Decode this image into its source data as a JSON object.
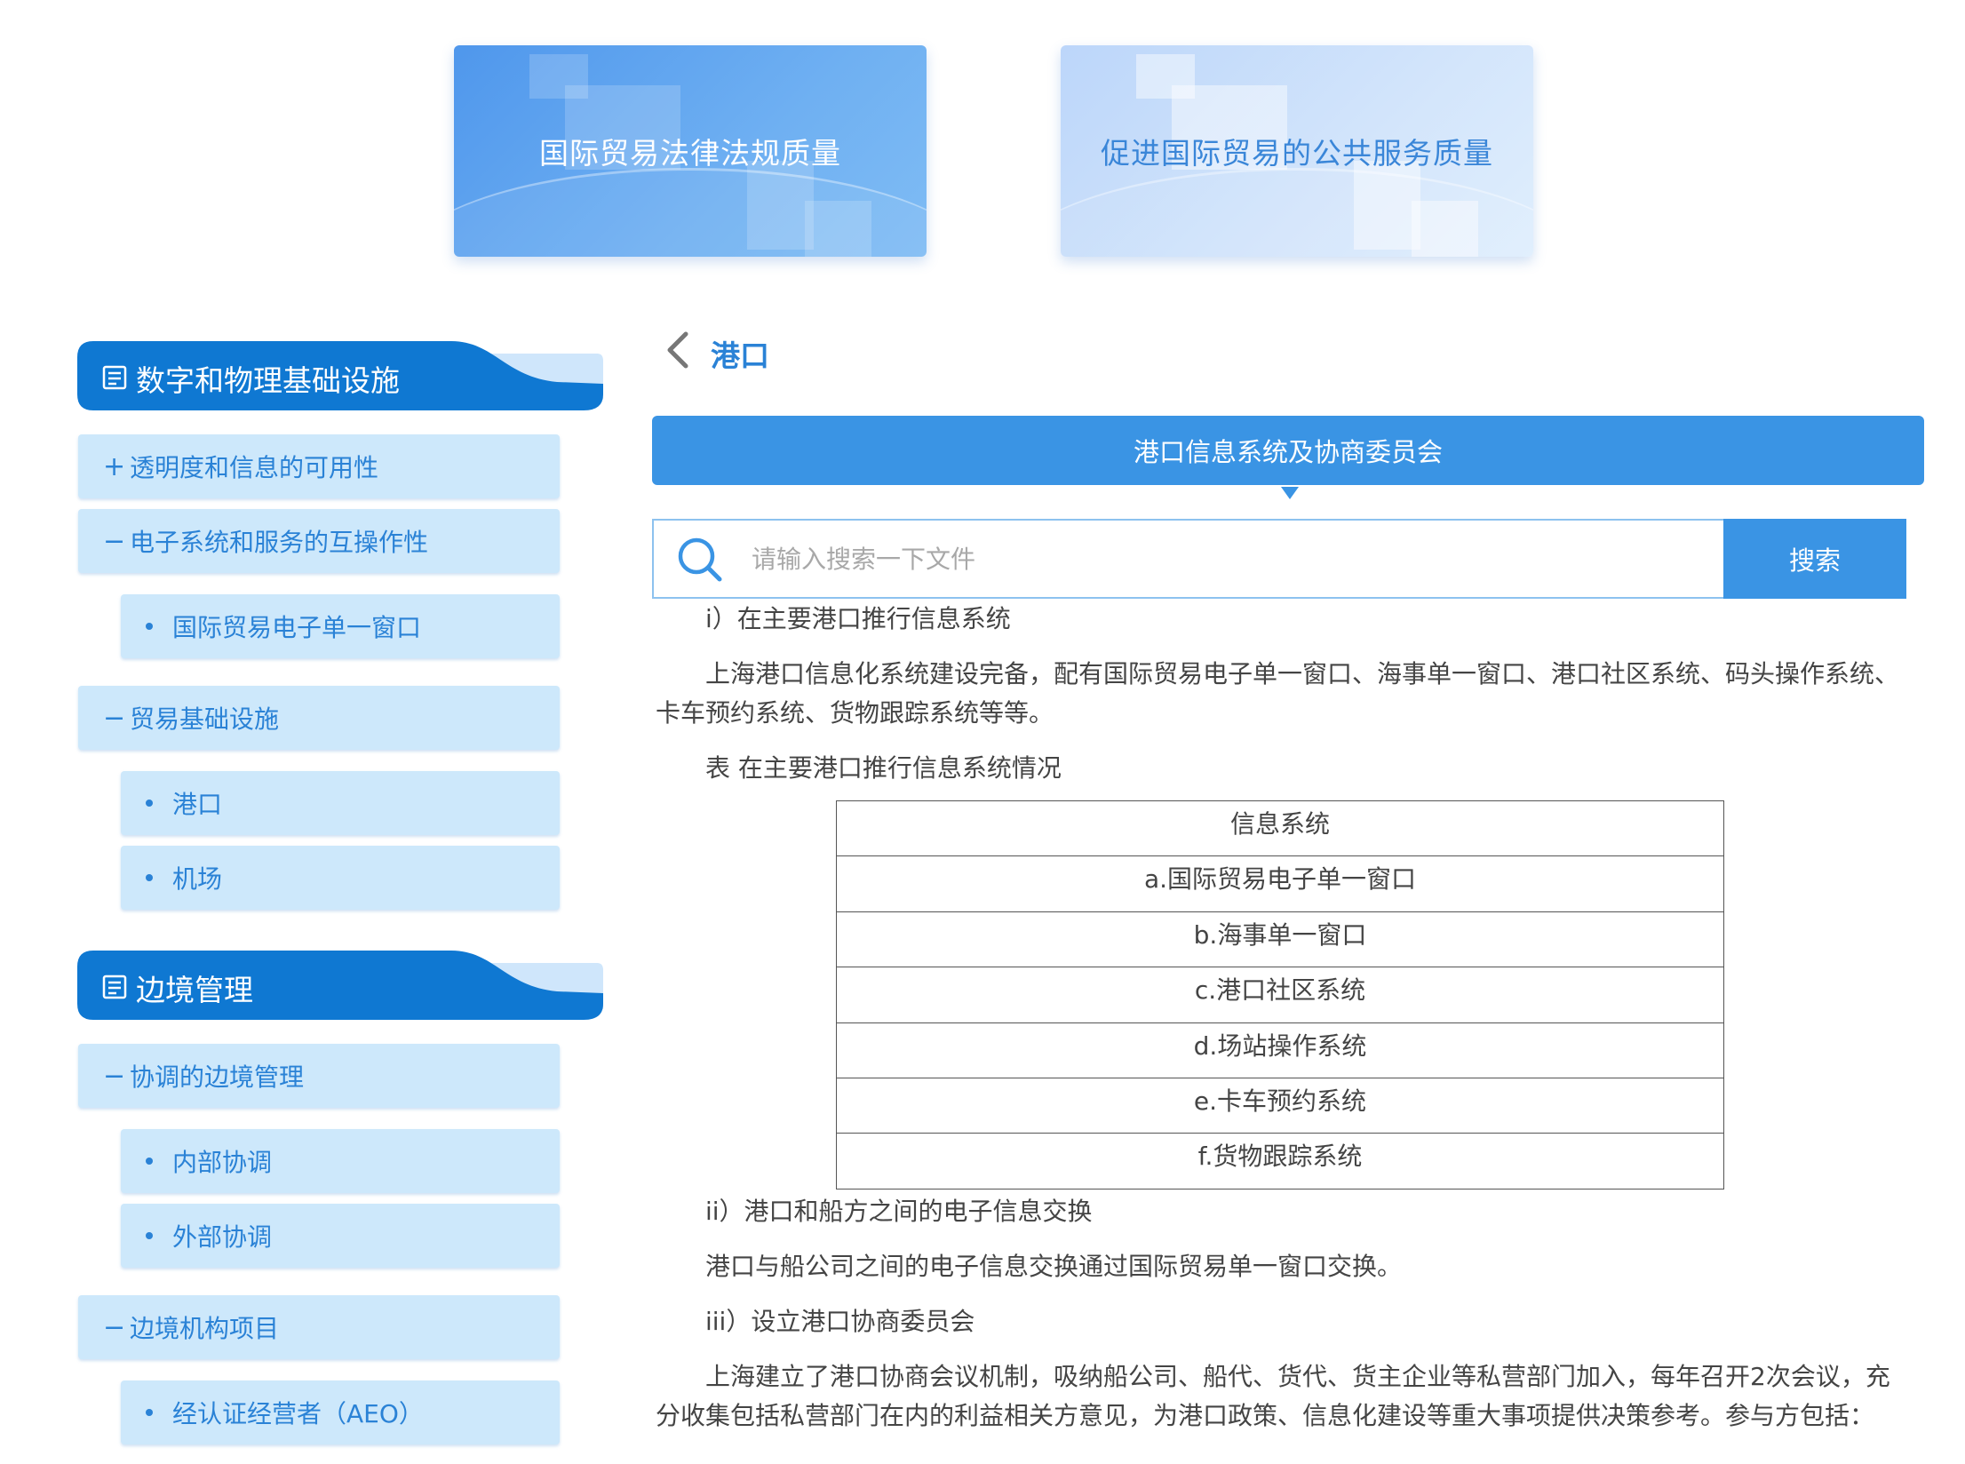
{
  "cards": [
    {
      "title": "国际贸易法律法规质量"
    },
    {
      "title": "促进国际贸易的公共服务质量"
    }
  ],
  "sidebar": {
    "sections": [
      {
        "title": "数字和物理基础设施",
        "items": [
          {
            "symbol": "+",
            "label": "透明度和信息的可用性"
          },
          {
            "symbol": "−",
            "label": "电子系统和服务的互操作性"
          },
          {
            "label": "国际贸易电子单一窗口"
          },
          {
            "symbol": "−",
            "label": "贸易基础设施"
          },
          {
            "label": "港口"
          },
          {
            "label": "机场"
          }
        ]
      },
      {
        "title": "边境管理",
        "items": [
          {
            "symbol": "−",
            "label": "协调的边境管理"
          },
          {
            "label": "内部协调"
          },
          {
            "label": "外部协调"
          },
          {
            "symbol": "−",
            "label": "边境机构项目"
          },
          {
            "label": "经认证经营者（AEO）"
          }
        ]
      }
    ]
  },
  "main": {
    "page_title": "港口",
    "subtab": "港口信息系统及协商委员会",
    "search": {
      "placeholder": "请输入搜索一下文件",
      "button": "搜索"
    },
    "content": {
      "h1": "i）在主要港口推行信息系统",
      "p1": "上海港口信息化系统建设完备，配有国际贸易电子单一窗口、海事单一窗口、港口社区系统、码头操作系统、卡车预约系统、货物跟踪系统等等。",
      "table_caption": "表 在主要港口推行信息系统情况",
      "table": {
        "header": "信息系统",
        "rows": [
          "a.国际贸易电子单一窗口",
          "b.海事单一窗口",
          "c.港口社区系统",
          "d.场站操作系统",
          "e.卡车预约系统",
          "f.货物跟踪系统"
        ]
      },
      "h2": "ii）港口和船方之间的电子信息交换",
      "p2": "港口与船公司之间的电子信息交换通过国际贸易单一窗口交换。",
      "h3": "iii）设立港口协商委员会",
      "p3": "上海建立了港口协商会议机制，吸纳船公司、船代、货代、货主企业等私营部门加入，每年召开2次会议，充分收集包括私营部门在内的利益相关方意见，为港口政策、信息化建设等重大事项提供决策参考。参与方包括："
    }
  },
  "colors": {
    "accent": "#3a94e4",
    "menu_bg": "#cde8fb",
    "menu_text": "#2a82d6",
    "header_dark": "#0f78d2"
  }
}
